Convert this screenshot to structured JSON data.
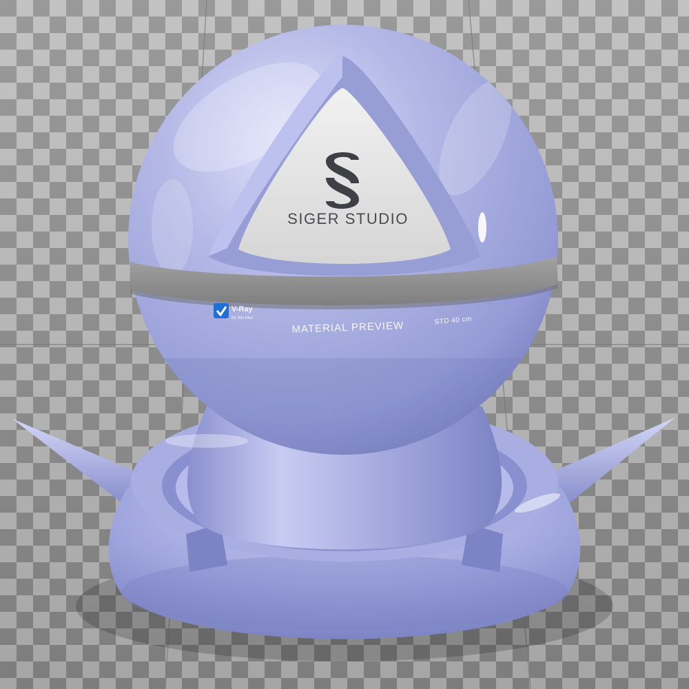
{
  "scene": {
    "subject": "material-preview-sphere",
    "colors": {
      "material": "#a7acdc",
      "material_shadow": "#6f76b8",
      "material_highlight": "#eef0ff",
      "floor_light": "#bdbdbd",
      "floor_dark": "#8f8f8f",
      "insert": "#e4e4e4",
      "band": "#8c8c8c",
      "logo_dark": "#3f3f46",
      "vray_blue": "#1f6fd6"
    }
  },
  "insert": {
    "logo_icon": "siger-s-icon",
    "brand": "SIGER STUDIO"
  },
  "band": {
    "vray_icon": "vray-check-icon",
    "vray_title": "V-Ray",
    "vray_subtitle": "for 3ds Max",
    "label": "MATERIAL PREVIEW",
    "size": "STD 40 cm"
  }
}
